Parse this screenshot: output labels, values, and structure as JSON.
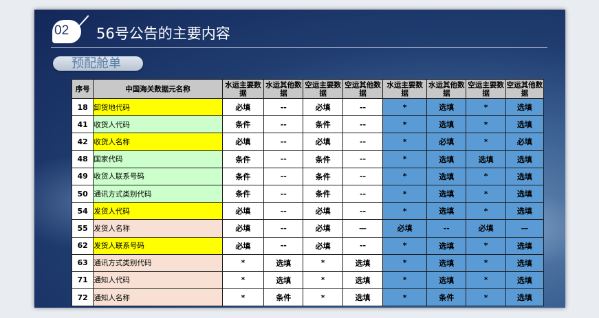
{
  "slide": {
    "section_number": "02",
    "title": "56号公告的主要内容",
    "tag": "预配舱单"
  },
  "table": {
    "headers": [
      "序号",
      "中国海关数据元名称",
      "水运主要数据",
      "水运其他数据",
      "空运主要数据",
      "空运其他数据",
      "水运主要数据",
      "水运其他数据",
      "空运主要数据",
      "空运其他数据"
    ],
    "rows": [
      {
        "seq": "18",
        "name": "卸货地代码",
        "color": "yellow",
        "cells": [
          "必填",
          "--",
          "必填",
          "--",
          "*",
          "选填",
          "*",
          "选填"
        ]
      },
      {
        "seq": "41",
        "name": "收货人代码",
        "color": "green",
        "cells": [
          "条件",
          "--",
          "条件",
          "--",
          "*",
          "选填",
          "*",
          "选填"
        ]
      },
      {
        "seq": "42",
        "name": "收货人名称",
        "color": "yellow",
        "cells": [
          "必填",
          "--",
          "必填",
          "--",
          "*",
          "必填",
          "*",
          "必填"
        ]
      },
      {
        "seq": "48",
        "name": "国家代码",
        "color": "green",
        "cells": [
          "条件",
          "--",
          "条件",
          "--",
          "*",
          "选填",
          "选填",
          "选填"
        ]
      },
      {
        "seq": "49",
        "name": "收货人联系号码",
        "color": "green",
        "cells": [
          "条件",
          "--",
          "条件",
          "--",
          "*",
          "选填",
          "*",
          "选填"
        ]
      },
      {
        "seq": "50",
        "name": "通讯方式类别代码",
        "color": "green",
        "cells": [
          "条件",
          "--",
          "条件",
          "--",
          "*",
          "选填",
          "*",
          "选填"
        ]
      },
      {
        "seq": "54",
        "name": "发货人代码",
        "color": "yellow",
        "cells": [
          "必填",
          "--",
          "必填",
          "--",
          "*",
          "选填",
          "*",
          "选填"
        ]
      },
      {
        "seq": "55",
        "name": "发货人名称",
        "color": "peach",
        "cells": [
          "必填",
          "--",
          "必填",
          "—",
          "必填",
          "--",
          "必填",
          "—"
        ]
      },
      {
        "seq": "62",
        "name": "发货人联系号码",
        "color": "yellow",
        "cells": [
          "必填",
          "--",
          "必填",
          "--",
          "*",
          "选填",
          "*",
          "选填"
        ]
      },
      {
        "seq": "63",
        "name": "通讯方式类别代码",
        "color": "peach",
        "cells": [
          "*",
          "选填",
          "*",
          "选填",
          "*",
          "选填",
          "*",
          "选填"
        ]
      },
      {
        "seq": "71",
        "name": "通知人代码",
        "color": "peach",
        "cells": [
          "*",
          "选填",
          "*",
          "选填",
          "*",
          "选填",
          "*",
          "选填"
        ]
      },
      {
        "seq": "72",
        "name": "通知人名称",
        "color": "peach",
        "cells": [
          "*",
          "条件",
          "*",
          "选填",
          "*",
          "条件",
          "*",
          "选填"
        ]
      }
    ]
  }
}
